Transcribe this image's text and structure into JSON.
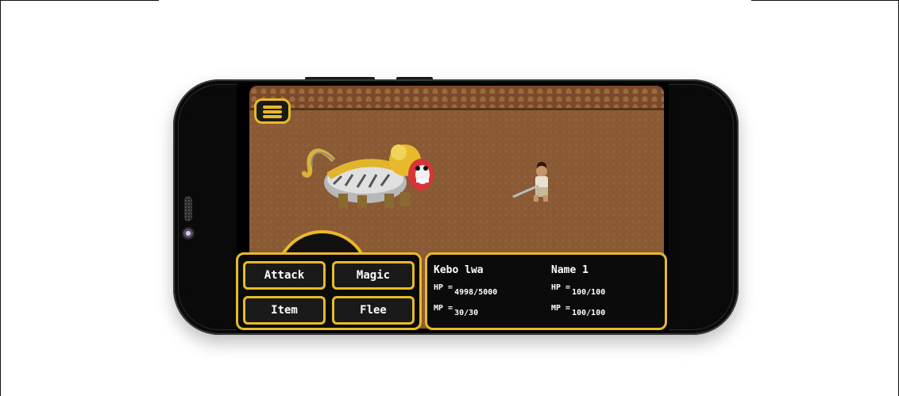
{
  "menu": {
    "icon": "hamburger-menu-icon"
  },
  "commands": {
    "attack": "Attack",
    "magic": "Magic",
    "item": "Item",
    "flee": "Flee"
  },
  "enemy": {
    "name": "Kebo lwa",
    "hp_label": "HP =",
    "hp_value": "4998/5000",
    "mp_label": "MP =",
    "mp_value": "30/30"
  },
  "player": {
    "name": "Name 1",
    "hp_label": "HP =",
    "hp_value": "100/100",
    "mp_label": "MP =",
    "mp_value": "100/100"
  },
  "colors": {
    "accent": "#e8b92a",
    "panel_bg": "#0b0b0b",
    "ground": "#8a5a34"
  }
}
